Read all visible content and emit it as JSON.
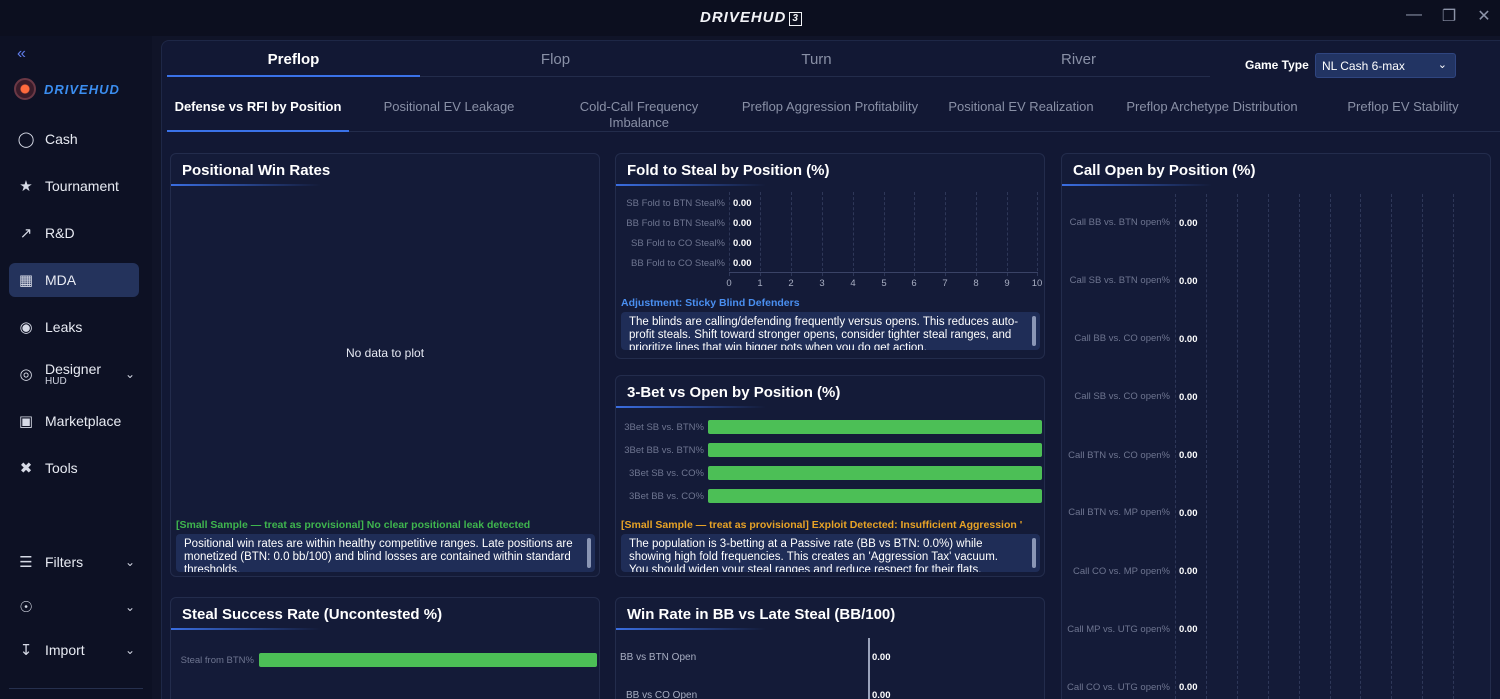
{
  "titlebar": {
    "brand": "DRIVEHUD",
    "brand_badge": "3"
  },
  "sidebar": {
    "logo_text": "DRIVEHUD",
    "items": [
      {
        "label": "Cash",
        "icon": "cash-icon"
      },
      {
        "label": "Tournament",
        "icon": "trophy-icon"
      },
      {
        "label": "R&D",
        "icon": "chart-line-icon"
      },
      {
        "label": "MDA",
        "icon": "grid-icon",
        "active": true
      },
      {
        "label": "Leaks",
        "icon": "drop-icon"
      },
      {
        "label": "Designer",
        "sublabel": "HUD",
        "icon": "eye-icon"
      },
      {
        "label": "Marketplace",
        "icon": "store-icon"
      },
      {
        "label": "Tools",
        "icon": "tools-icon"
      },
      {
        "label": "Filters",
        "icon": "filter-icon"
      },
      {
        "label": "",
        "icon": "user-icon"
      },
      {
        "label": "Import",
        "icon": "import-icon"
      }
    ]
  },
  "tabs": [
    "Preflop",
    "Flop",
    "Turn",
    "River"
  ],
  "game_type": {
    "label": "Game Type",
    "value": "NL Cash 6-max"
  },
  "subtabs": [
    "Defense vs RFI by Position",
    "Positional EV Leakage",
    "Cold-Call Frequency Imbalance",
    "Preflop Aggression Profitability",
    "Positional EV Realization",
    "Preflop Archetype Distribution",
    "Preflop EV Stability"
  ],
  "panels": {
    "win_rates": {
      "title": "Positional Win Rates",
      "empty": "No data to plot",
      "note": "[Small Sample — treat as provisional] No clear positional leak detected",
      "text": "Positional win rates are within healthy competitive ranges. Late positions are monetized (BTN: 0.0 bb/100) and blind losses are contained within standard thresholds."
    },
    "fold_steal": {
      "title": "Fold to Steal by Position (%)",
      "rows": [
        {
          "label": "SB Fold to BTN Steal%",
          "value": "0.00"
        },
        {
          "label": "BB Fold to BTN Steal%",
          "value": "0.00"
        },
        {
          "label": "SB Fold to CO Steal%",
          "value": "0.00"
        },
        {
          "label": "BB Fold to CO Steal%",
          "value": "0.00"
        }
      ],
      "ticks": [
        "0",
        "1",
        "2",
        "3",
        "4",
        "5",
        "6",
        "7",
        "8",
        "9",
        "10"
      ],
      "note": "Adjustment: Sticky Blind Defenders",
      "text": "The blinds are calling/defending frequently versus opens. This reduces auto-profit steals. Shift toward stronger opens, consider tighter steal ranges, and prioritize lines that win bigger pots when you do get action."
    },
    "threebet": {
      "title": "3-Bet vs Open by Position (%)",
      "rows": [
        {
          "label": "3Bet SB vs. BTN%",
          "fill": 1
        },
        {
          "label": "3Bet BB vs. BTN%",
          "fill": 1
        },
        {
          "label": "3Bet SB vs. CO%",
          "fill": 1
        },
        {
          "label": "3Bet BB vs. CO%",
          "fill": 1
        }
      ],
      "note": "[Small Sample — treat as provisional] Exploit Detected: Insufficient Aggression '",
      "text": "The population is 3-betting at a Passive rate (BB vs BTN: 0.0%) while showing high fold frequencies. This creates an 'Aggression Tax' vacuum. You should widen your steal ranges and reduce respect for their flats."
    },
    "call_open": {
      "title": "Call Open by Position (%)",
      "rows": [
        {
          "label": "Call BB vs. BTN open%",
          "value": "0.00"
        },
        {
          "label": "Call SB vs. BTN open%",
          "value": "0.00"
        },
        {
          "label": "Call BB vs. CO open%",
          "value": "0.00"
        },
        {
          "label": "Call SB vs. CO open%",
          "value": "0.00"
        },
        {
          "label": "Call BTN vs. CO open%",
          "value": "0.00"
        },
        {
          "label": "Call BTN vs. MP open%",
          "value": "0.00"
        },
        {
          "label": "Call CO vs. MP open%",
          "value": "0.00"
        },
        {
          "label": "Call MP vs. UTG open%",
          "value": "0.00"
        },
        {
          "label": "Call CO vs. UTG open%",
          "value": "0.00"
        }
      ]
    },
    "steal_success": {
      "title": "Steal Success Rate (Uncontested %)",
      "rows": [
        {
          "label": "Steal from BTN%",
          "fill": 1
        }
      ]
    },
    "bb_winrate": {
      "title": "Win Rate in BB vs Late Steal (BB/100)",
      "rows": [
        {
          "label": "BB vs BTN Open",
          "value": "0.00"
        },
        {
          "label": "BB vs CO Open",
          "value": "0.00"
        }
      ]
    }
  }
}
